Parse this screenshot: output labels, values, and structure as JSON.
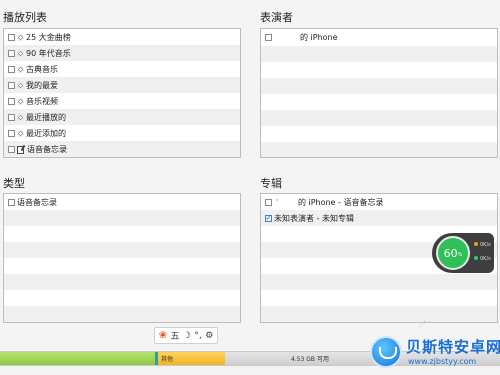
{
  "playlists": {
    "title": "播放列表",
    "items": [
      {
        "icon": "gear",
        "label": "25 大金曲榜"
      },
      {
        "icon": "gear",
        "label": "90 年代音乐"
      },
      {
        "icon": "gear",
        "label": "古典音乐"
      },
      {
        "icon": "gear",
        "label": "我的最爱"
      },
      {
        "icon": "gear",
        "label": "音乐视频"
      },
      {
        "icon": "gear",
        "label": "最近播放的"
      },
      {
        "icon": "gear",
        "label": "最近添加的"
      },
      {
        "icon": "memo",
        "label": "语音备忘录"
      }
    ]
  },
  "artists": {
    "title": "表演者",
    "items": [
      {
        "label": "的 iPhone"
      }
    ]
  },
  "genres": {
    "title": "类型",
    "items": [
      {
        "label": "语音备忘录"
      }
    ]
  },
  "albums": {
    "title": "专辑",
    "items": [
      {
        "mark": "'",
        "label": "的 iPhone - 语音备忘录",
        "checked": false
      },
      {
        "mark": "",
        "label": "未知表演者 - 未知专辑",
        "checked": true
      }
    ]
  },
  "capacity": {
    "other_label": "其他",
    "free_label": "4.53 GB 可用"
  },
  "ime_toolbar": {
    "paw_icon": "paw-icon",
    "item_wu": "五",
    "item_moon": "☽",
    "item_dot": "°,",
    "item_gear": "⚙"
  },
  "speed_widget": {
    "percent": "60",
    "percent_sign": "%",
    "up": "0K/s",
    "down": "0K/s"
  },
  "watermark": {
    "title": "贝斯特安卓网",
    "url": "www.zjbstyy.com"
  },
  "colors": {
    "audio": "#8cc94a",
    "other": "#f0b424",
    "free": "#d6d6d6",
    "speed_green": "#30c05a"
  }
}
